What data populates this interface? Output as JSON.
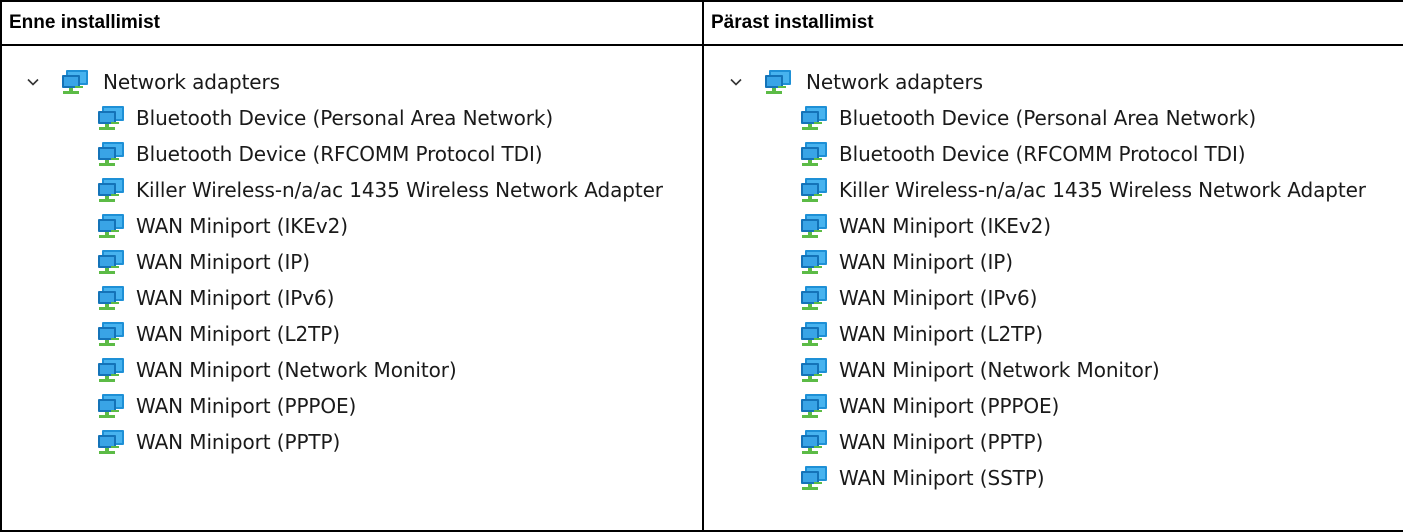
{
  "table": {
    "headers": [
      "Enne installimist",
      "Pärast installimist"
    ],
    "before": {
      "root_label": "Network adapters",
      "items": [
        "Bluetooth Device (Personal Area Network)",
        "Bluetooth Device (RFCOMM Protocol TDI)",
        "Killer Wireless-n/a/ac 1435 Wireless Network Adapter",
        "WAN Miniport (IKEv2)",
        "WAN Miniport (IP)",
        "WAN Miniport (IPv6)",
        "WAN Miniport (L2TP)",
        "WAN Miniport (Network Monitor)",
        "WAN Miniport (PPPOE)",
        "WAN Miniport (PPTP)"
      ]
    },
    "after": {
      "root_label": "Network adapters",
      "items": [
        "Bluetooth Device (Personal Area Network)",
        "Bluetooth Device (RFCOMM Protocol TDI)",
        "Killer Wireless-n/a/ac 1435 Wireless Network Adapter",
        "WAN Miniport (IKEv2)",
        "WAN Miniport (IP)",
        "WAN Miniport (IPv6)",
        "WAN Miniport (L2TP)",
        "WAN Miniport (Network Monitor)",
        "WAN Miniport (PPPOE)",
        "WAN Miniport (PPTP)",
        "WAN Miniport (SSTP)"
      ]
    }
  },
  "icons": {
    "expand": "chevron-down-icon",
    "adapter": "network-adapter-icon"
  },
  "colors": {
    "border": "#000000",
    "monitor_blue": "#1e90d6",
    "cable_green": "#5cbb46"
  }
}
